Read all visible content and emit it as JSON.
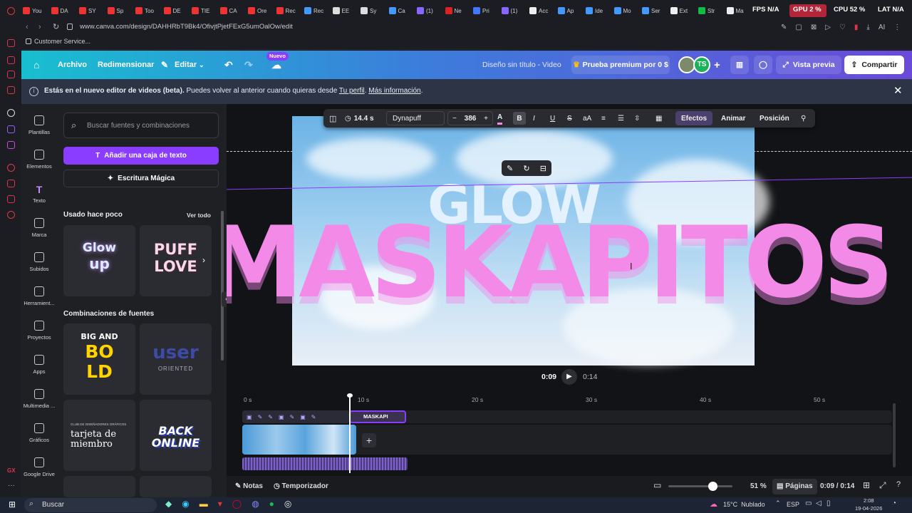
{
  "browser": {
    "tabs": [
      "You",
      "DA",
      "SY",
      "Sp",
      "Too",
      "DE",
      "TIE",
      "CA",
      "Ore",
      "Rec",
      "Rec",
      "EE",
      "Sy",
      "Ca",
      "(1)",
      "Ne",
      "Pri",
      "(1)",
      "Acc",
      "Ap",
      "Ide",
      "Mo",
      "Ser",
      "Ext",
      "Str",
      "Ma"
    ],
    "url": "www.canva.com/design/DAHHRbT9Bk4/OfivjtPjetFExG5umOalOw/edit",
    "bookmark": "Customer Service...",
    "overlay": {
      "fps_label": "FPS",
      "fps_value": "N/A",
      "gpu_label": "GPU",
      "gpu_value": "2 %",
      "cpu_label": "CPU",
      "cpu_value": "52 %",
      "lat_label": "LAT",
      "lat_value": "N/A"
    }
  },
  "header": {
    "archivo": "Archivo",
    "redimensionar": "Redimensionar",
    "editar": "Editar",
    "nuevo_badge": "Nuevo",
    "title": "Diseño sin título - Video",
    "premium": "Prueba premium por 0 $",
    "avatar_initials": "TS",
    "vista_previa": "Vista previa",
    "compartir": "Compartir"
  },
  "info": {
    "bold": "Estás en el nuevo editor de videos (beta).",
    "text": " Puedes volver al anterior cuando quieras desde ",
    "link1": "Tu perfil",
    "sep": ". ",
    "link2": "Más información",
    "end": "."
  },
  "nav": [
    {
      "label": "Plantillas",
      "icon": "templates-icon"
    },
    {
      "label": "Elementos",
      "icon": "elements-icon"
    },
    {
      "label": "Texto",
      "icon": "text-icon"
    },
    {
      "label": "Marca",
      "icon": "brand-icon"
    },
    {
      "label": "Subidos",
      "icon": "upload-icon"
    },
    {
      "label": "Herramient...",
      "icon": "tools-icon"
    },
    {
      "label": "Proyectos",
      "icon": "folder-icon"
    },
    {
      "label": "Apps",
      "icon": "apps-icon"
    },
    {
      "label": "Multimedia ...",
      "icon": "media-icon"
    },
    {
      "label": "Gráficos",
      "icon": "chart-icon"
    },
    {
      "label": "Google Drive",
      "icon": "drive-icon"
    }
  ],
  "panel": {
    "search_placeholder": "Buscar fuentes y combinaciones",
    "add_text": "Añadir una caja de texto",
    "magic": "Escritura Mágica",
    "recent": "Usado hace poco",
    "see_all": "Ver todo",
    "combos": "Combinaciones de fuentes",
    "cards": {
      "glow1": "Glow",
      "glow2": "up",
      "puff1": "PUFF",
      "puff2": "LOVE",
      "big1": "BIG AND",
      "big2": "BO",
      "big3": "LD",
      "user1": "user",
      "user2": "ORIENTED",
      "club": "CLUB DE DISEÑADORES GRÁFICOS",
      "tarjeta": "tarjeta de miembro",
      "back": "BACK ONLINE"
    }
  },
  "toolbar": {
    "duration": "14.4 s",
    "font": "Dynapuff",
    "size": "386",
    "efectos": "Efectos",
    "animar": "Animar",
    "posicion": "Posición"
  },
  "canvas": {
    "glow": "GLOW",
    "main": "MASKAPITOS"
  },
  "player": {
    "current": "0:09",
    "total": "0:14"
  },
  "timeline": {
    "ticks": [
      "0 s",
      "10 s",
      "20 s",
      "30 s",
      "40 s",
      "50 s"
    ],
    "text_clip": "MASKAPI"
  },
  "bottom": {
    "notas": "Notas",
    "temporizador": "Temporizador",
    "zoom": "51 %",
    "zoom_level": 0.51,
    "paginas": "Páginas",
    "time": "0:09 / 0:14"
  },
  "taskbar": {
    "search": "Buscar",
    "weather": "15°C  Nublado",
    "lang": "ESP",
    "time": "2:08",
    "date": "19-04-2026"
  },
  "colors": {
    "accent": "#8b3dff",
    "pink": "#f48ae8"
  }
}
